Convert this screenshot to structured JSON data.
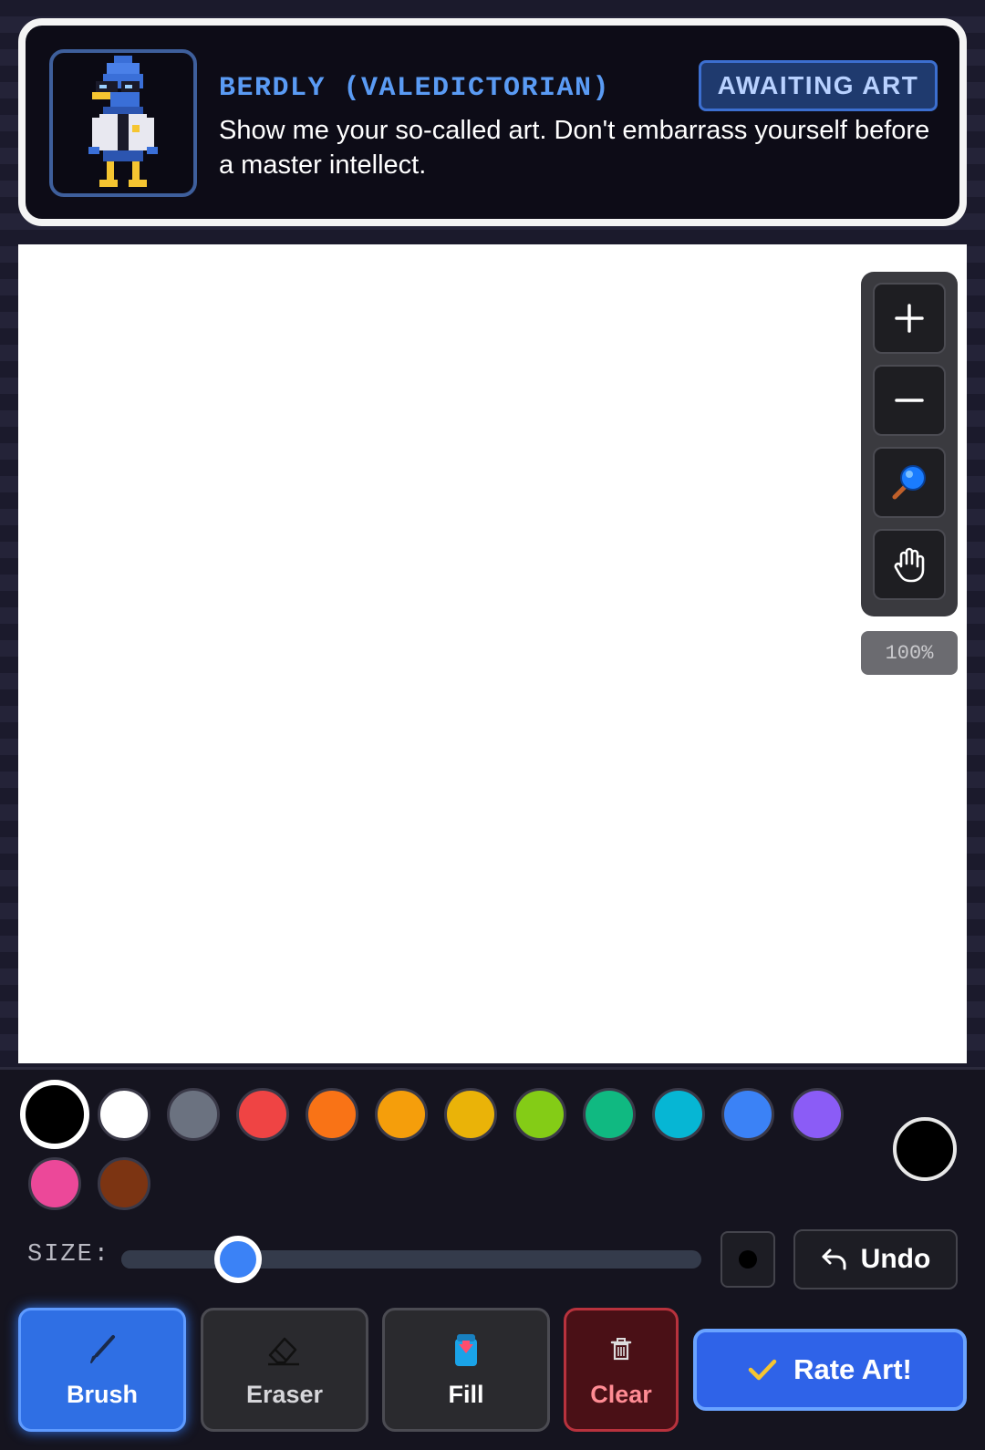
{
  "header": {
    "speaker": "BERDLY (VALEDICTORIAN)",
    "status": "AWAITING ART",
    "dialogue": "Show me your so-called art. Don't embarrass yourself before a master intellect."
  },
  "zoom": {
    "buttons": [
      "zoom-in-icon",
      "zoom-out-icon",
      "magnifier-icon",
      "hand-icon"
    ],
    "level": "100%"
  },
  "palette": {
    "colors": [
      "#000000",
      "#ffffff",
      "#6b7280",
      "#ef4444",
      "#f97316",
      "#f59e0b",
      "#eab308",
      "#84cc16",
      "#10b981",
      "#06b6d4",
      "#3b82f6",
      "#8b5cf6",
      "#ec4899",
      "#7c3412"
    ],
    "selected_index": 0,
    "current_color": "#000000"
  },
  "size": {
    "label": "SIZE:",
    "fraction": 0.16
  },
  "undo_label": "Undo",
  "tools": {
    "brush": "Brush",
    "eraser": "Eraser",
    "fill": "Fill",
    "clear": "Clear",
    "active": "brush"
  },
  "rate_label": "Rate Art!"
}
